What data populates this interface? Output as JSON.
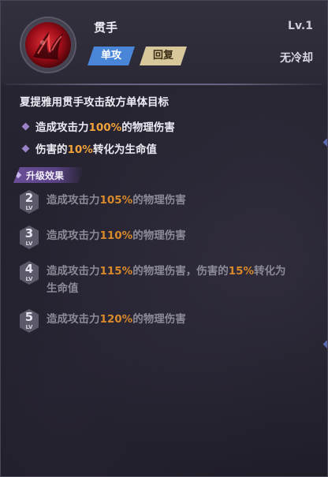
{
  "skill": {
    "name": "贯手",
    "level": "Lv.1",
    "tags": [
      "单攻",
      "回复"
    ],
    "cooldown": "无冷却",
    "icon": "red-claw-icon"
  },
  "description": {
    "main": "夏提雅用贯手攻击敌方单体目标",
    "effects": [
      {
        "pre": "造成攻击力",
        "value": "100%",
        "post": "的物理伤害"
      },
      {
        "pre": "伤害的",
        "value": "10%",
        "post": "转化为生命值"
      }
    ]
  },
  "upgrade": {
    "title": "升级效果",
    "lv_label": "LV",
    "items": [
      {
        "level": "2",
        "parts": [
          {
            "t": "造成攻击力"
          },
          {
            "t": "105%",
            "hl": true
          },
          {
            "t": "的物理伤害"
          }
        ]
      },
      {
        "level": "3",
        "parts": [
          {
            "t": "造成攻击力"
          },
          {
            "t": "110%",
            "hl": true
          },
          {
            "t": "的物理伤害"
          }
        ]
      },
      {
        "level": "4",
        "parts": [
          {
            "t": "造成攻击力"
          },
          {
            "t": "115%",
            "hl": true
          },
          {
            "t": "的物理伤害，伤害的"
          },
          {
            "t": "15%",
            "hl": true
          },
          {
            "t": "转化为"
          }
        ],
        "line2": "生命值"
      },
      {
        "level": "5",
        "parts": [
          {
            "t": "造成攻击力"
          },
          {
            "t": "120%",
            "hl": true
          },
          {
            "t": "的物理伤害"
          }
        ]
      }
    ]
  },
  "colors": {
    "highlight": "#f0a13a",
    "tag_attack": "#4a86d8",
    "tag_heal": "#d8c79a",
    "accent_purple": "#6a4f98"
  }
}
